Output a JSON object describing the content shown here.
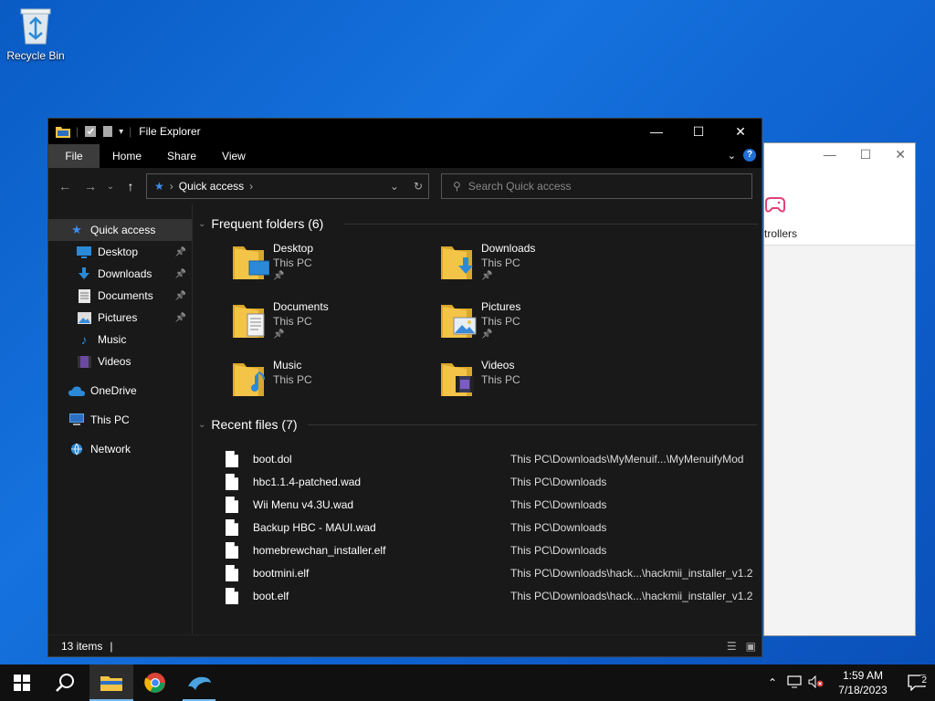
{
  "desktop": {
    "recycle_bin_label": "Recycle Bin"
  },
  "background_window": {
    "partial_label": "trollers",
    "accent": "#e0417a"
  },
  "explorer": {
    "title": "File Explorer",
    "ribbon_tabs": [
      "File",
      "Home",
      "Share",
      "View"
    ],
    "address_crumb": "Quick access",
    "search_placeholder": "Search Quick access",
    "sidebar": [
      {
        "label": "Quick access",
        "icon": "star-icon",
        "pinned": false,
        "indent": 0,
        "selected": true
      },
      {
        "label": "Desktop",
        "icon": "desktop-icon",
        "pinned": true,
        "indent": 1,
        "selected": false
      },
      {
        "label": "Downloads",
        "icon": "download-icon",
        "pinned": true,
        "indent": 1,
        "selected": false
      },
      {
        "label": "Documents",
        "icon": "document-icon",
        "pinned": true,
        "indent": 1,
        "selected": false
      },
      {
        "label": "Pictures",
        "icon": "picture-icon",
        "pinned": true,
        "indent": 1,
        "selected": false
      },
      {
        "label": "Music",
        "icon": "music-icon",
        "pinned": false,
        "indent": 1,
        "selected": false
      },
      {
        "label": "Videos",
        "icon": "video-icon",
        "pinned": false,
        "indent": 1,
        "selected": false
      },
      {
        "label": "OneDrive",
        "icon": "cloud-icon",
        "pinned": false,
        "indent": 0,
        "selected": false
      },
      {
        "label": "This PC",
        "icon": "computer-icon",
        "pinned": false,
        "indent": 0,
        "selected": false
      },
      {
        "label": "Network",
        "icon": "network-icon",
        "pinned": false,
        "indent": 0,
        "selected": false
      }
    ],
    "frequent_header": "Frequent folders (6)",
    "frequent_folders": [
      {
        "name": "Desktop",
        "location": "This PC",
        "pinned": true,
        "icon": "desktop-icon"
      },
      {
        "name": "Downloads",
        "location": "This PC",
        "pinned": true,
        "icon": "download-icon"
      },
      {
        "name": "Documents",
        "location": "This PC",
        "pinned": true,
        "icon": "document-icon"
      },
      {
        "name": "Pictures",
        "location": "This PC",
        "pinned": true,
        "icon": "picture-icon"
      },
      {
        "name": "Music",
        "location": "This PC",
        "pinned": false,
        "icon": "music-icon"
      },
      {
        "name": "Videos",
        "location": "This PC",
        "pinned": false,
        "icon": "video-icon"
      }
    ],
    "recent_header": "Recent files (7)",
    "recent_files": [
      {
        "name": "boot.dol",
        "path": "This PC\\Downloads\\MyMenuif...\\MyMenuifyMod"
      },
      {
        "name": "hbc1.1.4-patched.wad",
        "path": "This PC\\Downloads"
      },
      {
        "name": "Wii Menu v4.3U.wad",
        "path": "This PC\\Downloads"
      },
      {
        "name": "Backup HBC - MAUI.wad",
        "path": "This PC\\Downloads"
      },
      {
        "name": "homebrewchan_installer.elf",
        "path": "This PC\\Downloads"
      },
      {
        "name": "bootmini.elf",
        "path": "This PC\\Downloads\\hack...\\hackmii_installer_v1.2"
      },
      {
        "name": "boot.elf",
        "path": "This PC\\Downloads\\hack...\\hackmii_installer_v1.2"
      }
    ],
    "status_items": "13 items"
  },
  "taskbar": {
    "time": "1:59 AM",
    "date": "7/18/2023",
    "notification_count": "2"
  }
}
